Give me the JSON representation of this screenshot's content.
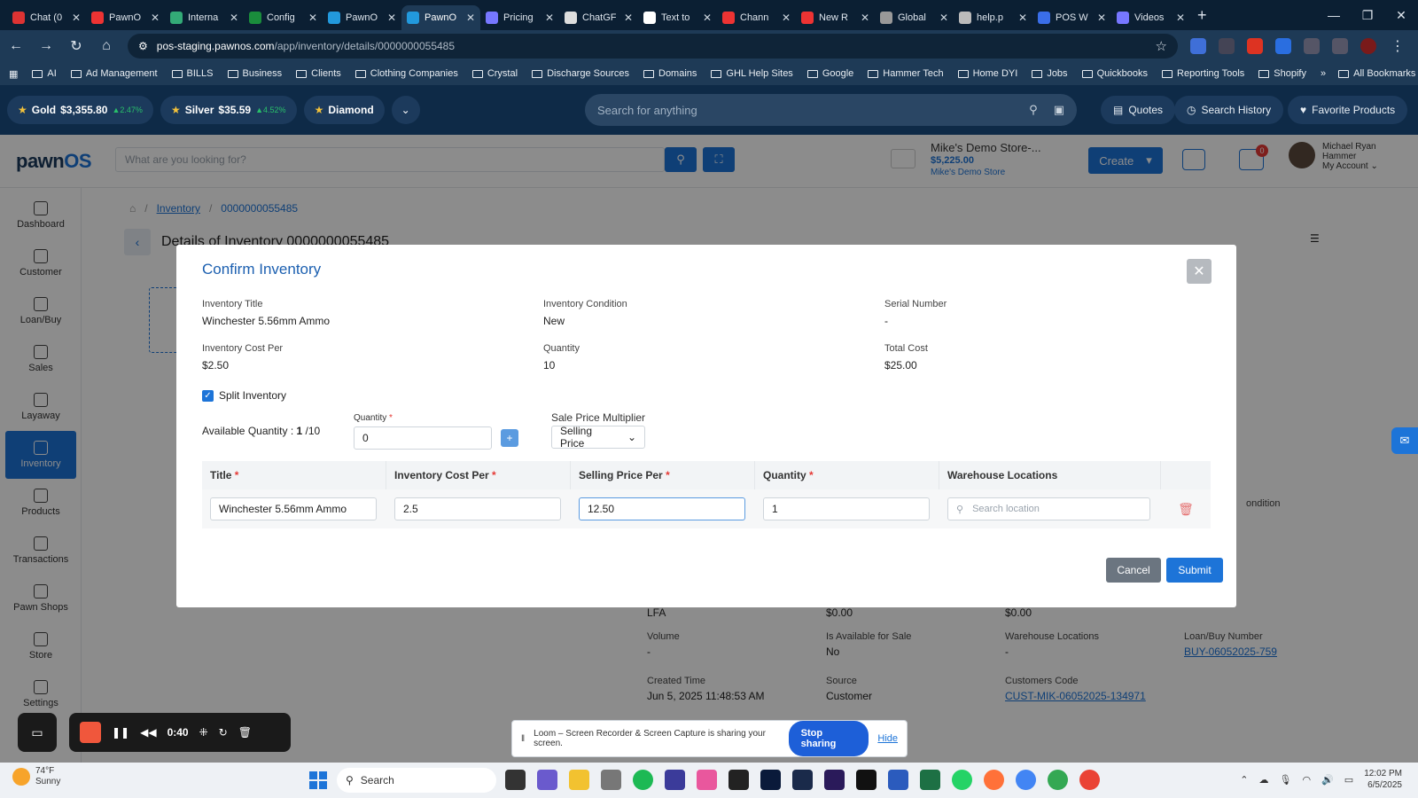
{
  "browser": {
    "tabs": [
      {
        "title": "Chat (0",
        "color": "#d33"
      },
      {
        "title": "PawnO",
        "color": "#e33"
      },
      {
        "title": "Interna",
        "color": "#3a7"
      },
      {
        "title": "Config",
        "color": "#1a8d3c"
      },
      {
        "title": "PawnO",
        "color": "#29d"
      },
      {
        "title": "PawnO",
        "color": "#29d"
      },
      {
        "title": "Pricing",
        "color": "#77f"
      },
      {
        "title": "ChatGF",
        "color": "#ddd"
      },
      {
        "title": "Text to",
        "color": "#fff"
      },
      {
        "title": "Chann",
        "color": "#e33"
      },
      {
        "title": "New R",
        "color": "#e33"
      },
      {
        "title": "Global",
        "color": "#999"
      },
      {
        "title": "help.p",
        "color": "#bbb"
      },
      {
        "title": "POS W",
        "color": "#3a6ee8"
      },
      {
        "title": "Videos",
        "color": "#77f"
      }
    ],
    "active_tab_index": 5,
    "url_host": "pos-staging.pawnos.com",
    "url_path": "/app/inventory/details/0000000055485",
    "bookmarks": [
      "AI",
      "Ad Management",
      "BILLS",
      "Business",
      "Clients",
      "Clothing Companies",
      "Crystal",
      "Discharge Sources",
      "Domains",
      "GHL Help Sites",
      "Google",
      "Hammer Tech",
      "Home DYI",
      "Jobs",
      "Quickbooks",
      "Reporting Tools",
      "Shopify"
    ],
    "all_bookmarks": "All Bookmarks"
  },
  "pricebar": {
    "gold": {
      "label": "Gold",
      "price": "$3,355.80",
      "change": "2.47%"
    },
    "silver": {
      "label": "Silver",
      "price": "$35.59",
      "change": "4.52%"
    },
    "diamond": {
      "label": "Diamond"
    },
    "search_placeholder": "Search for anything",
    "quotes": "Quotes",
    "search_history": "Search History",
    "favorite_products": "Favorite Products"
  },
  "app": {
    "logo_main": "pawn",
    "logo_accent": "OS",
    "search_placeholder": "What are you looking for?",
    "store_name": "Mike's Demo Store-...",
    "store_balance": "$5,225.00",
    "store_sub": "Mike's Demo Store",
    "create_label": "Create",
    "notif_count": "0",
    "user_name_1": "Michael Ryan",
    "user_name_2": "Hammer",
    "user_account": "My Account"
  },
  "sidebar": {
    "items": [
      {
        "label": "Dashboard"
      },
      {
        "label": "Customer"
      },
      {
        "label": "Loan/Buy"
      },
      {
        "label": "Sales"
      },
      {
        "label": "Layaway"
      },
      {
        "label": "Inventory"
      },
      {
        "label": "Products"
      },
      {
        "label": "Transactions"
      },
      {
        "label": "Pawn Shops"
      },
      {
        "label": "Store"
      },
      {
        "label": "Settings"
      }
    ],
    "active": "Inventory"
  },
  "page": {
    "breadcrumb_inventory": "Inventory",
    "breadcrumb_id": "0000000055485",
    "title": "Details of Inventory  0000000055485",
    "bg": {
      "lfa": "LFA",
      "zero_a": "$0.00",
      "zero_b": "$0.00",
      "condition": "ondition",
      "volume_label": "Volume",
      "volume_value": "-",
      "avail_label": "Is Available for Sale",
      "avail_value": "No",
      "wh_label": "Warehouse Locations",
      "wh_value": "-",
      "loan_label": "Loan/Buy Number",
      "loan_value": "BUY-06052025-759",
      "created_label": "Created Time",
      "created_value": "Jun 5, 2025 11:48:53 AM",
      "source_label": "Source",
      "source_value": "Customer",
      "cust_label": "Customers Code",
      "cust_value": "CUST-MIK-06052025-134971"
    }
  },
  "modal": {
    "title": "Confirm Inventory",
    "fields": {
      "inventory_title": {
        "label": "Inventory Title",
        "value": "Winchester 5.56mm Ammo"
      },
      "inventory_condition": {
        "label": "Inventory Condition",
        "value": "New"
      },
      "serial_number": {
        "label": "Serial Number",
        "value": "-"
      },
      "cost_per": {
        "label": "Inventory Cost Per",
        "value": "$2.50"
      },
      "quantity": {
        "label": "Quantity",
        "value": "10"
      },
      "total_cost": {
        "label": "Total Cost",
        "value": "$25.00"
      }
    },
    "split_label": "Split Inventory",
    "split_checked": true,
    "available_label": "Available Quantity : ",
    "available_value": "1",
    "available_total": " /10",
    "quantity_label": "Quantity",
    "quantity_value": "0",
    "multiplier_label": "Sale Price Multiplier",
    "multiplier_value": "Selling Price",
    "table": {
      "headers": {
        "title": "Title",
        "cost": "Inventory Cost Per",
        "price": "Selling Price Per",
        "qty": "Quantity",
        "warehouse": "Warehouse Locations"
      },
      "row": {
        "title": "Winchester 5.56mm Ammo",
        "cost": "2.5",
        "price": "12.50",
        "qty": "1",
        "location_placeholder": "Search location"
      }
    },
    "cancel": "Cancel",
    "submit": "Submit"
  },
  "recorder": {
    "time": "0:40",
    "loom_text": "Loom – Screen Recorder & Screen Capture is sharing your screen.",
    "stop_sharing": "Stop sharing",
    "hide": "Hide"
  },
  "taskbar": {
    "temp": "74°F",
    "condition": "Sunny",
    "weather_badge": "4",
    "search": "Search",
    "time": "12:02 PM",
    "date": "6/5/2025"
  }
}
